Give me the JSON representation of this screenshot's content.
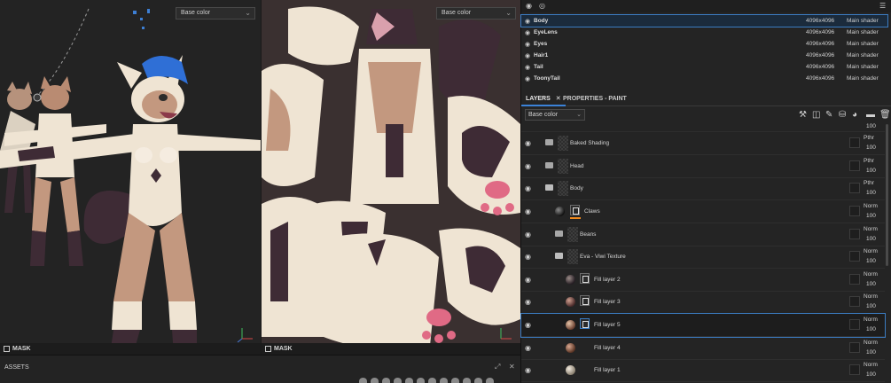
{
  "viewport3d": {
    "channel_select": "Base color",
    "mask_label": "MASK"
  },
  "viewport2d": {
    "channel_select": "Base color",
    "mask_label": "MASK"
  },
  "assets": {
    "title": "ASSETS"
  },
  "texture_sets": [
    {
      "name": "Body",
      "resolution": "4096x4096",
      "shader": "Main shader",
      "selected": true
    },
    {
      "name": "EyeLens",
      "resolution": "4096x4096",
      "shader": "Main shader"
    },
    {
      "name": "Eyes",
      "resolution": "4096x4096",
      "shader": "Main shader"
    },
    {
      "name": "Hair1",
      "resolution": "4096x4096",
      "shader": "Main shader"
    },
    {
      "name": "Tail",
      "resolution": "4096x4096",
      "shader": "Main shader"
    },
    {
      "name": "ToonyTail",
      "resolution": "4096x4096",
      "shader": "Main shader"
    }
  ],
  "tabs": {
    "layers": "LAYERS",
    "properties": "PROPERTIES - PAINT"
  },
  "layer_channel_select": "Base color",
  "layers": {
    "top_partial": {
      "opacity": "100"
    },
    "baked_shading": {
      "name": "Baked Shading",
      "blend": "Pthr",
      "opacity": "100"
    },
    "head": {
      "name": "Head",
      "blend": "Pthr",
      "opacity": "100"
    },
    "body": {
      "name": "Body",
      "blend": "Pthr",
      "opacity": "100"
    },
    "claws": {
      "name": "Claws",
      "blend": "Norm",
      "opacity": "100"
    },
    "beans": {
      "name": "Beans",
      "blend": "Norm",
      "opacity": "100"
    },
    "eva": {
      "name": "Eva - Viwi Texture",
      "blend": "Norm",
      "opacity": "100"
    },
    "fill2": {
      "name": "Fill layer 2",
      "blend": "Norm",
      "opacity": "100"
    },
    "fill3": {
      "name": "Fill layer 3",
      "blend": "Norm",
      "opacity": "100"
    },
    "fill5": {
      "name": "Fill layer 5",
      "blend": "Norm",
      "opacity": "100"
    },
    "fill4": {
      "name": "Fill layer 4",
      "blend": "Norm",
      "opacity": "100"
    },
    "fill1": {
      "name": "Fill layer 1",
      "blend": "Norm",
      "opacity": "100"
    }
  },
  "colors": {
    "accent": "#3b82d8",
    "selection_outline": "#3b7cc2",
    "mask_orange": "#f08a1e",
    "character_cream": "#efe4d3",
    "character_tan": "#c3987f",
    "character_dark": "#3e2b35",
    "hair_blue": "#2f6fd6"
  }
}
